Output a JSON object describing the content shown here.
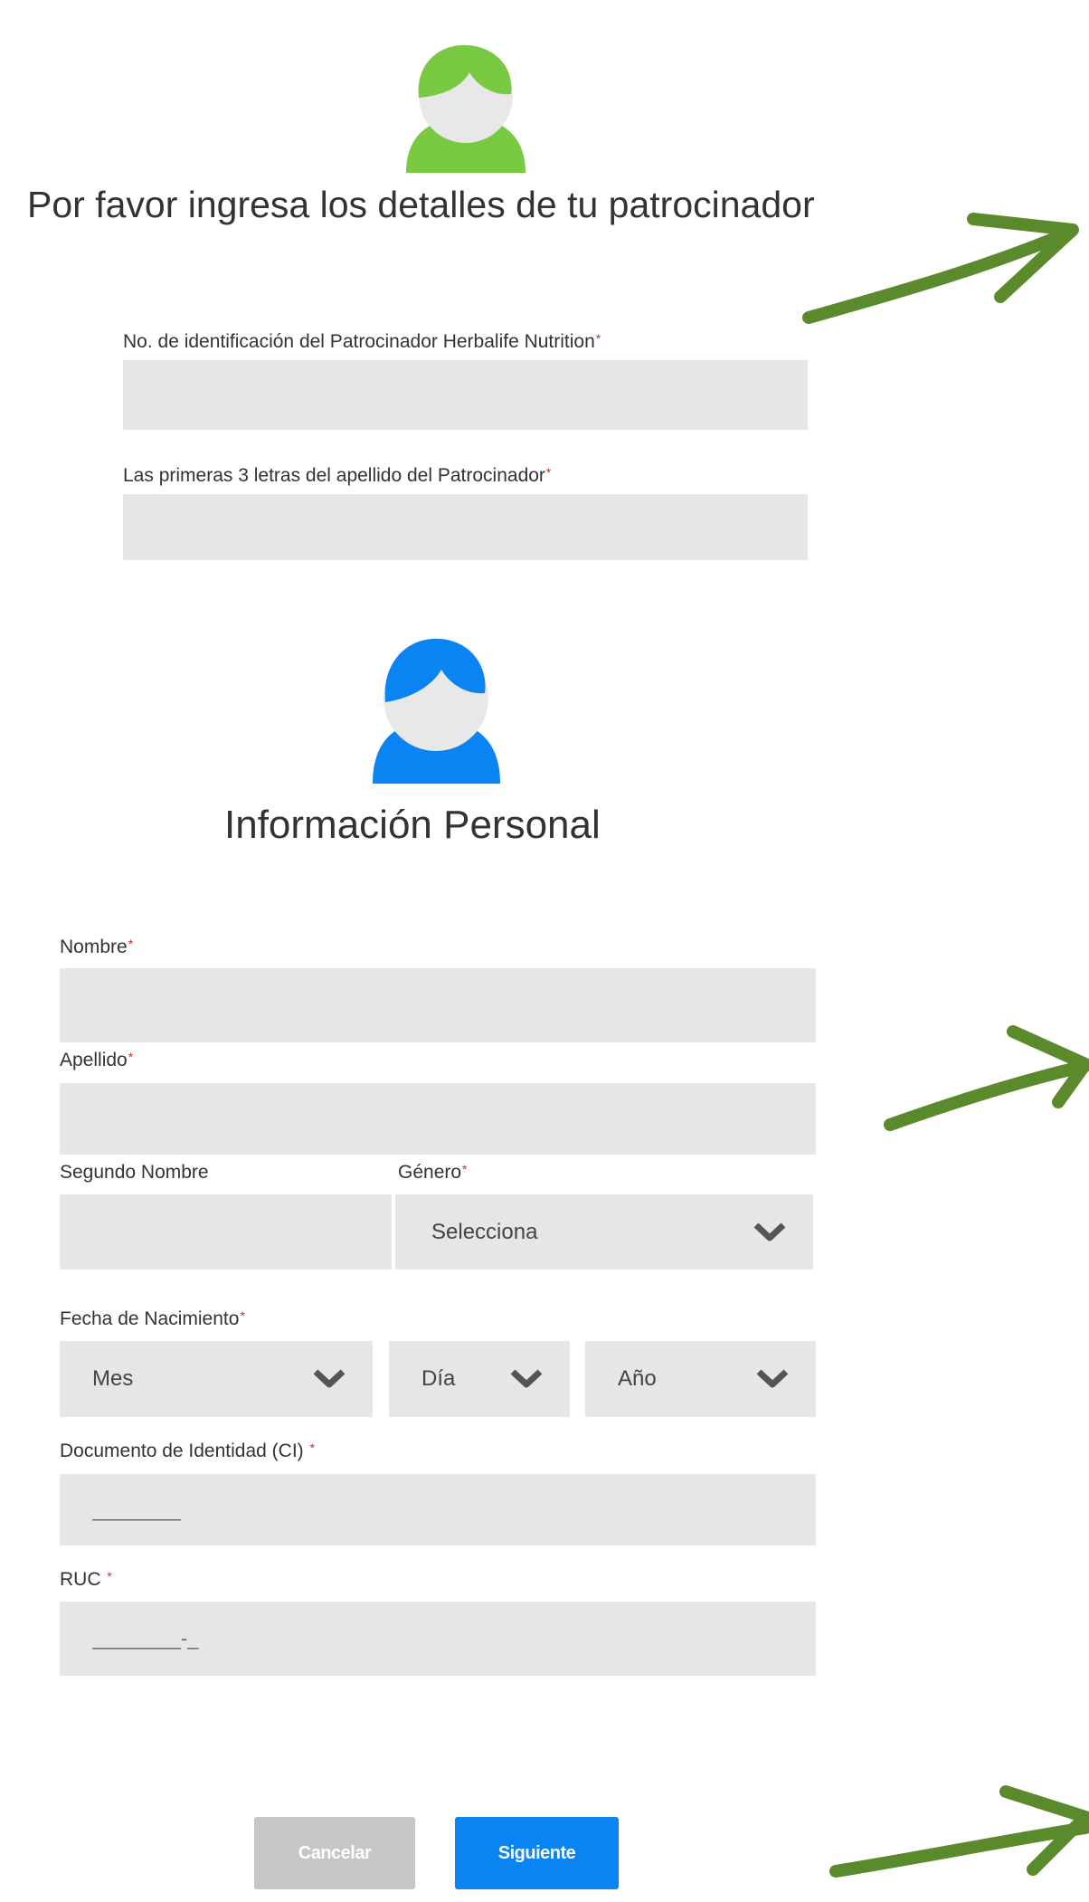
{
  "sponsor": {
    "title": "Por favor ingresa los detalles de tu patrocinador",
    "id_label": "No. de identificación del Patrocinador Herbalife Nutrition",
    "id_value": "",
    "lastname_label": "Las primeras 3 letras del apellido del Patrocinador",
    "lastname_value": ""
  },
  "personal": {
    "title": "Información Personal",
    "first_name_label": "Nombre",
    "last_name_label": "Apellido",
    "middle_name_label": "Segundo Nombre",
    "gender_label": "Género",
    "gender_value": "Selecciona",
    "birthdate_label": "Fecha de Nacimiento",
    "month_value": "Mes",
    "day_value": "Día",
    "year_value": "Año",
    "id_doc_label": "Documento de Identidad (CI)",
    "id_doc_placeholder": "________",
    "ruc_label": "RUC",
    "ruc_placeholder": "________-_"
  },
  "buttons": {
    "cancel": "Cancelar",
    "next": "Siguiente"
  },
  "required_marker": "*",
  "colors": {
    "sponsor_avatar": "#7ac943",
    "personal_avatar": "#0b84f3",
    "arrows": "#5a8a2b",
    "field_bg": "#e6e6e6",
    "required": "#e2231a"
  }
}
